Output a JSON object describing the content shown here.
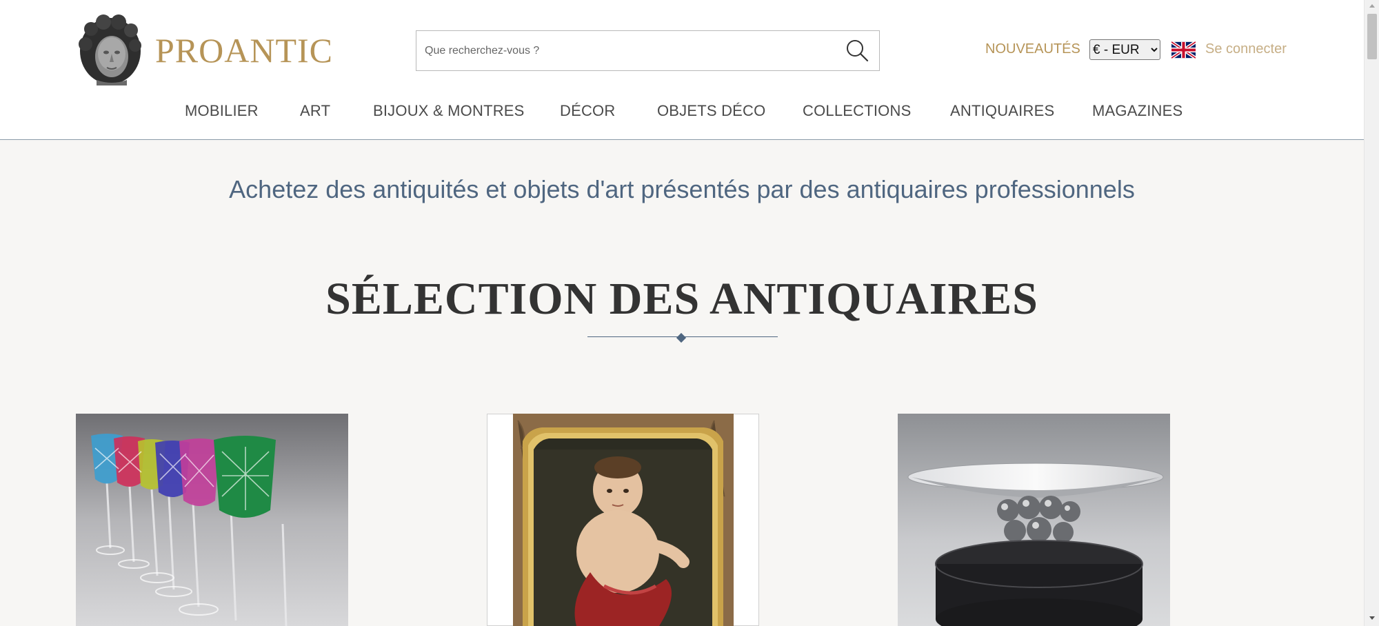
{
  "header": {
    "brand": "PROANTIC",
    "search_placeholder": "Que recherchez-vous ?",
    "new_label": "NOUVEAUTÉS",
    "currency_selected": "€ - EUR",
    "login_label": "Se connecter"
  },
  "nav": {
    "items": [
      "MOBILIER",
      "ART",
      "BIJOUX & MONTRES",
      "DÉCOR",
      "OBJETS DÉCO",
      "COLLECTIONS",
      "ANTIQUAIRES",
      "MAGAZINES"
    ]
  },
  "main": {
    "tagline": "Achetez des antiquités et objets d'art présentés par des antiquaires professionnels",
    "section_title": "SÉLECTION DES ANTIQUAIRES"
  },
  "colors": {
    "brand_gold": "#b69457",
    "login_gold": "#c6ae85",
    "tagline_blue": "#4f6680",
    "page_bg": "#f7f6f4"
  },
  "icons": {
    "search": "search-icon",
    "flag": "uk-flag-icon",
    "logo": "sculpted-head-logo"
  }
}
